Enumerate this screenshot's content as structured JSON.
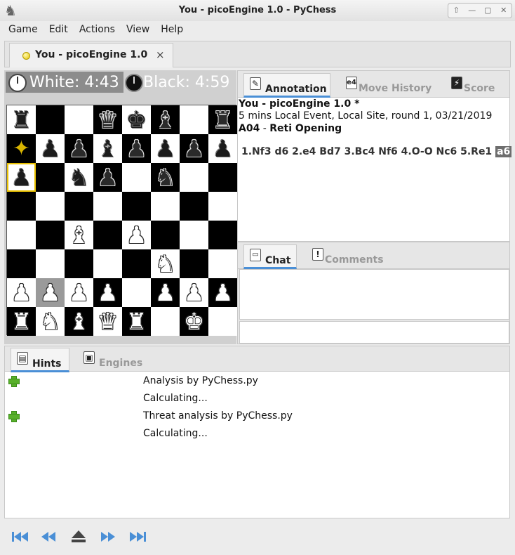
{
  "window": {
    "title": "You - picoEngine 1.0 - PyChess"
  },
  "menu": [
    "Game",
    "Edit",
    "Actions",
    "View",
    "Help"
  ],
  "document_tab": {
    "label": "You - picoEngine 1.0",
    "close": "×"
  },
  "clocks": {
    "white": "White: 4:43",
    "black": "Black: 4:59"
  },
  "board": {
    "ranks": [
      [
        "bR",
        "",
        "",
        "bQ",
        "bK",
        "bB",
        "",
        "bR"
      ],
      [
        "star",
        "bP",
        "bP",
        "bB",
        "bP",
        "bP",
        "bP",
        "bP"
      ],
      [
        "bP",
        "",
        "bN",
        "bP",
        "",
        "bN",
        "",
        ""
      ],
      [
        "",
        "",
        "",
        "",
        "",
        "",
        "",
        ""
      ],
      [
        "",
        "",
        "wB",
        "",
        "wP",
        "",
        "",
        ""
      ],
      [
        "",
        "",
        "",
        "",
        "",
        "wN",
        "",
        ""
      ],
      [
        "wP",
        "wP",
        "wP",
        "wP",
        "",
        "wP",
        "wP",
        "wP"
      ],
      [
        "wR",
        "wN",
        "wB",
        "wQ",
        "wR",
        "",
        "wK",
        ""
      ]
    ],
    "highlight": [
      "a6",
      "a7",
      "b2"
    ]
  },
  "annotation_tabs": [
    {
      "label": "Annotation",
      "icon": "pencil-icon",
      "icon_text": "✎"
    },
    {
      "label": "Move History",
      "icon": "e4-icon",
      "icon_text": "e4"
    },
    {
      "label": "Score",
      "icon": "score-icon",
      "icon_text": "⚡"
    }
  ],
  "annotation": {
    "title": "You - picoEngine 1.0 *",
    "event": "5 mins Local Event, Local Site, round 1, 03/21/2019",
    "eco": "A04",
    "opening_sep": " - ",
    "opening": "Reti Opening",
    "moves": "1.Nf3 d6 2.e4 Bd7 3.Bc4 Nf6 4.O-O Nc6 5.Re1 ",
    "last_move": "a6"
  },
  "chat_tabs": [
    {
      "label": "Chat",
      "icon": "chat-icon",
      "icon_text": "💬"
    },
    {
      "label": "Comments",
      "icon": "comments-icon",
      "icon_text": "!"
    }
  ],
  "hints_tabs": [
    {
      "label": "Hints",
      "icon": "hints-icon",
      "icon_text": "▤"
    },
    {
      "label": "Engines",
      "icon": "engines-icon",
      "icon_text": "▣"
    }
  ],
  "hints": [
    {
      "text": "Analysis by PyChess.py",
      "expandable": true
    },
    {
      "text": "Calculating...",
      "expandable": false
    },
    {
      "text": "Threat analysis by PyChess.py",
      "expandable": true
    },
    {
      "text": "Calculating...",
      "expandable": false
    }
  ],
  "nav": [
    "first-move",
    "previous-move",
    "eject",
    "next-move",
    "last-move"
  ],
  "colors": {
    "accent": "#4a8fd6",
    "clock_active": "#8c8c8c",
    "move_highlight": "#6e6e6e",
    "plus_green": "#58b02a"
  }
}
